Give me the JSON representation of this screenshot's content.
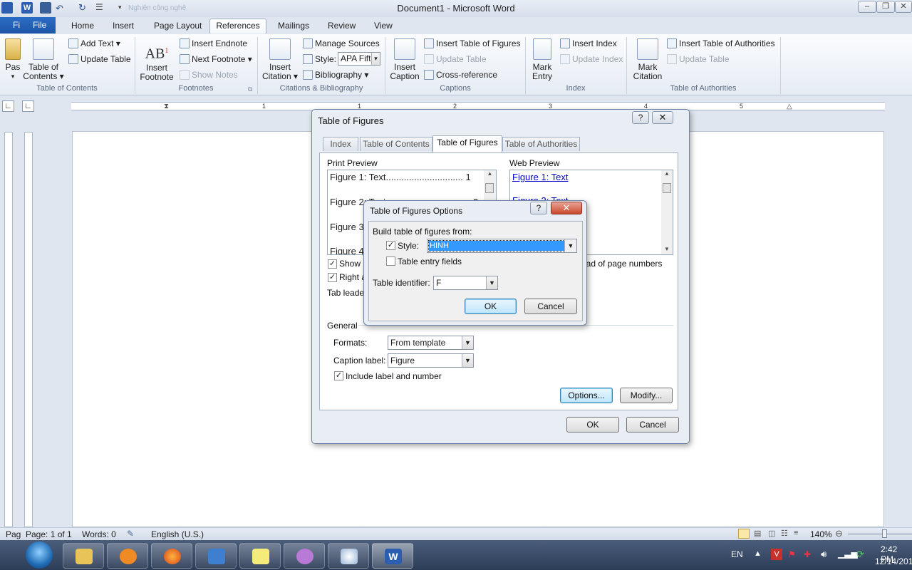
{
  "window": {
    "title": "Document1 - Microsoft Word",
    "faded_text": "Nghiện công nghệ"
  },
  "menu": {
    "file_partial": "Fi",
    "file": "File",
    "tabs": [
      "Home",
      "Insert",
      "Page Layout",
      "References",
      "Mailings",
      "Review",
      "View"
    ],
    "active_tab": "References"
  },
  "ribbon": {
    "toc_group": {
      "paste_partial": "Pas",
      "toc_line1": "Table of",
      "toc_line2": "Contents",
      "add_text": "Add Text",
      "update_table": "Update Table",
      "label": "Table of Contents"
    },
    "footnotes_group": {
      "insert_footnote_line1": "Insert",
      "insert_footnote_line2": "Footnote",
      "insert_endnote": "Insert Endnote",
      "next_footnote": "Next Footnote",
      "show_notes": "Show Notes",
      "label": "Footnotes"
    },
    "citations_group": {
      "insert_citation_line1": "Insert",
      "insert_citation_line2": "Citation",
      "manage_sources": "Manage Sources",
      "style_label": "Style:",
      "style_value": "APA Fiftl",
      "bibliography": "Bibliography",
      "label": "Citations & Bibliography"
    },
    "captions_group": {
      "insert_caption_line1": "Insert",
      "insert_caption_line2": "Caption",
      "insert_tof": "Insert Table of Figures",
      "update_table": "Update Table",
      "cross_reference": "Cross-reference",
      "label": "Captions"
    },
    "index_group": {
      "mark_entry_line1": "Mark",
      "mark_entry_line2": "Entry",
      "insert_index": "Insert Index",
      "update_index": "Update Index",
      "label": "Index"
    },
    "toa_group": {
      "mark_citation_line1": "Mark",
      "mark_citation_line2": "Citation",
      "insert_toa": "Insert Table of Authorities",
      "update_table": "Update Table",
      "label": "Table of Authorities"
    }
  },
  "ruler": {
    "numbers": [
      "1",
      "1",
      "2",
      "3",
      "4",
      "5",
      "6"
    ]
  },
  "tof_dialog": {
    "title": "Table of Figures",
    "help": "?",
    "close": "✕",
    "tabs": [
      "Index",
      "Table of Contents",
      "Table of Figures",
      "Table of Authorities"
    ],
    "active_tab": "Table of Figures",
    "print_preview_label": "Print Preview",
    "print_preview_lines": [
      "Figure 1: Text.............................. 1",
      "Figure 2: Text",
      "Figure 3",
      "Figure 4"
    ],
    "print_preview_page2": "2",
    "web_preview_label": "Web Preview",
    "web_preview_lines": [
      "Figure 1: Text",
      "Figure 2: Text"
    ],
    "show_page_numbers_partial": "Show p",
    "right_align_partial": "Right a",
    "hyperlinks_partial": "ead of page numbers",
    "tab_leader_partial": "Tab leader",
    "general_label": "General",
    "formats_label": "Formats:",
    "formats_value": "From template",
    "caption_label_label": "Caption label:",
    "caption_label_value": "Figure",
    "include_label_number": "Include label and number",
    "options_button": "Options...",
    "modify_button": "Modify...",
    "ok_button": "OK",
    "cancel_button": "Cancel"
  },
  "options_dialog": {
    "title": "Table of Figures Options",
    "help": "?",
    "close": "✕",
    "build_from_label": "Build table of figures from:",
    "style_label": "Style:",
    "style_value": "HINH",
    "style_checked": true,
    "table_entry_fields_label": "Table entry fields",
    "table_entry_fields_checked": false,
    "table_identifier_label": "Table identifier:",
    "table_identifier_value": "F",
    "ok_button": "OK",
    "cancel_button": "Cancel"
  },
  "status": {
    "page_partial": "Pag",
    "page": "Page: 1 of 1",
    "words": "Words: 0",
    "language": "English (U.S.)",
    "zoom": "140%"
  },
  "taskbar": {
    "language": "EN",
    "time": "2:42 PM",
    "date": "12/14/201"
  },
  "colors": {
    "accent": "#1d56a8",
    "selection": "#3399ff",
    "link": "#0000cc"
  }
}
